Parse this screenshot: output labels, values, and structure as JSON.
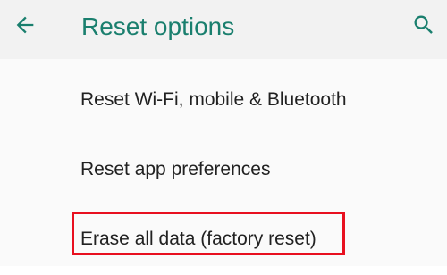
{
  "app_bar": {
    "back_icon": "arrow-left-icon",
    "title": "Reset options",
    "search_icon": "search-icon"
  },
  "items": [
    {
      "label": "Reset Wi-Fi, mobile & Bluetooth"
    },
    {
      "label": "Reset app preferences"
    },
    {
      "label": "Erase all data (factory reset)"
    }
  ],
  "colors": {
    "accent": "#1a7f6e",
    "highlight": "#e8101f"
  }
}
